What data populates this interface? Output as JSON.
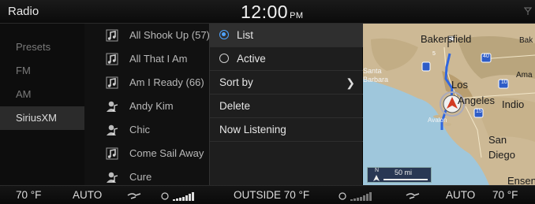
{
  "header": {
    "title": "Radio",
    "time": "12:00",
    "ampm": "PM"
  },
  "sidebar": {
    "items": [
      {
        "label": "Presets"
      },
      {
        "label": "FM"
      },
      {
        "label": "AM"
      },
      {
        "label": "SiriusXM"
      }
    ]
  },
  "stations": [
    {
      "label": "All Shook Up (57)",
      "icon": "music-note-icon"
    },
    {
      "label": "All That I Am",
      "icon": "music-note-icon"
    },
    {
      "label": "Am I Ready (66)",
      "icon": "music-note-icon"
    },
    {
      "label": "Andy Kim",
      "icon": "artist-icon"
    },
    {
      "label": "Chic",
      "icon": "artist-icon"
    },
    {
      "label": "Come Sail Away",
      "icon": "music-note-icon"
    },
    {
      "label": "Cure",
      "icon": "artist-icon"
    }
  ],
  "menu": {
    "list": "List",
    "active": "Active",
    "sort_by": "Sort by",
    "delete": "Delete",
    "now_listening": "Now Listening"
  },
  "map": {
    "places": [
      "Bakersfield",
      "Bak",
      "Santa",
      "Barbara",
      "Los",
      "Angeles",
      "Ama",
      "Indio",
      "Avalon",
      "San",
      "Diego",
      "Ensen"
    ],
    "highways": [
      "5",
      "40",
      "10",
      "15"
    ],
    "scale": "50 mi",
    "north": "N"
  },
  "climate": {
    "left_temp": "70 °F",
    "left_mode": "AUTO",
    "outside": "OUTSIDE  70 °F",
    "right_mode": "AUTO",
    "right_temp": "70 °F"
  },
  "colors": {
    "accent": "#4fa3ff",
    "route": "#2f66e0"
  }
}
